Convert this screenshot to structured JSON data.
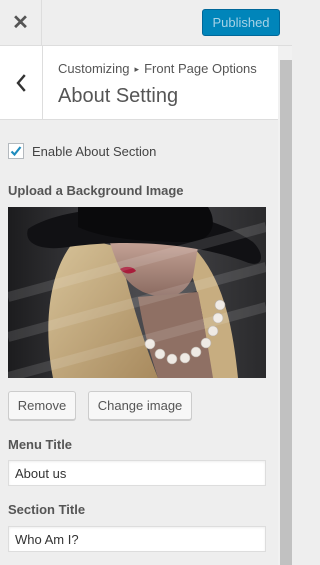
{
  "topbar": {
    "close_icon": "close-icon",
    "published_label": "Published"
  },
  "header": {
    "back_icon": "chevron-left-icon",
    "breadcrumb_root": "Customizing",
    "breadcrumb_separator": "▸",
    "breadcrumb_parent": "Front Page Options",
    "title": "About Setting"
  },
  "controls": {
    "enable_label": "Enable About Section",
    "enable_checked": true,
    "upload_label": "Upload a Background Image",
    "remove_label": "Remove",
    "change_label": "Change image",
    "menu_title_label": "Menu Title",
    "menu_title_value": "About us",
    "section_title_label": "Section Title",
    "section_title_value": "Who Am I?"
  },
  "colors": {
    "primary": "#0085ba",
    "checkbox_check": "#1e8cbe"
  }
}
